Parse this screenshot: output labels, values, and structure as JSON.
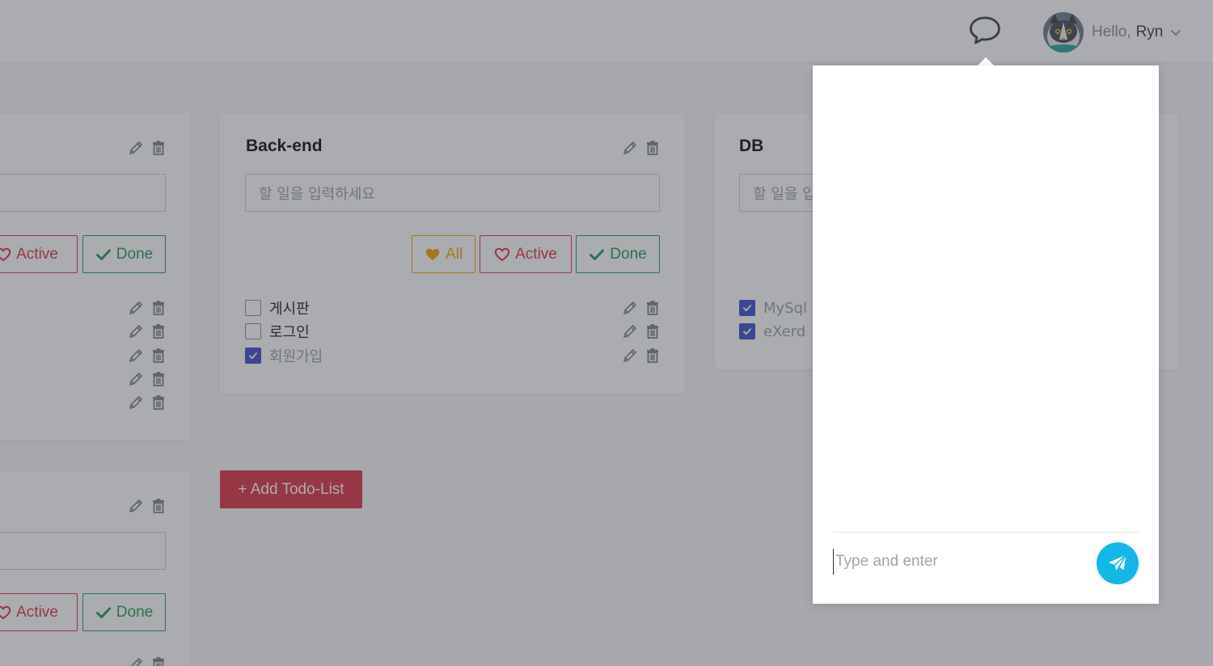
{
  "header": {
    "hello": "Hello,",
    "username": "Ryn"
  },
  "filters": {
    "all": "All",
    "active": "Active",
    "done": "Done"
  },
  "lists": {
    "left_top": {
      "items_count_visible": 5
    },
    "backend": {
      "title": "Back-end",
      "placeholder": "할 일을 입력하세요",
      "items": [
        {
          "text": "게시판",
          "checked": false
        },
        {
          "text": "로그인",
          "checked": false
        },
        {
          "text": "회원가입",
          "checked": true
        }
      ]
    },
    "db": {
      "title": "DB",
      "placeholder": "할 일을 입",
      "items": [
        {
          "text": "MySql",
          "checked": true
        },
        {
          "text": "eXerd",
          "checked": true
        }
      ]
    }
  },
  "add_list_label": "+ Add Todo-List",
  "chat": {
    "placeholder": "Type and enter"
  },
  "colors": {
    "all": "#f0a500",
    "active": "#dc3545",
    "done": "#1e9e57",
    "checkbox": "#3f51c8",
    "send": "#14b8e8",
    "add_button": "#dc3545"
  },
  "icons": [
    "chat-bubble-icon",
    "chevron-down-icon",
    "pencil-icon",
    "trash-icon",
    "heart-icon",
    "check-icon",
    "paper-plane-icon"
  ]
}
